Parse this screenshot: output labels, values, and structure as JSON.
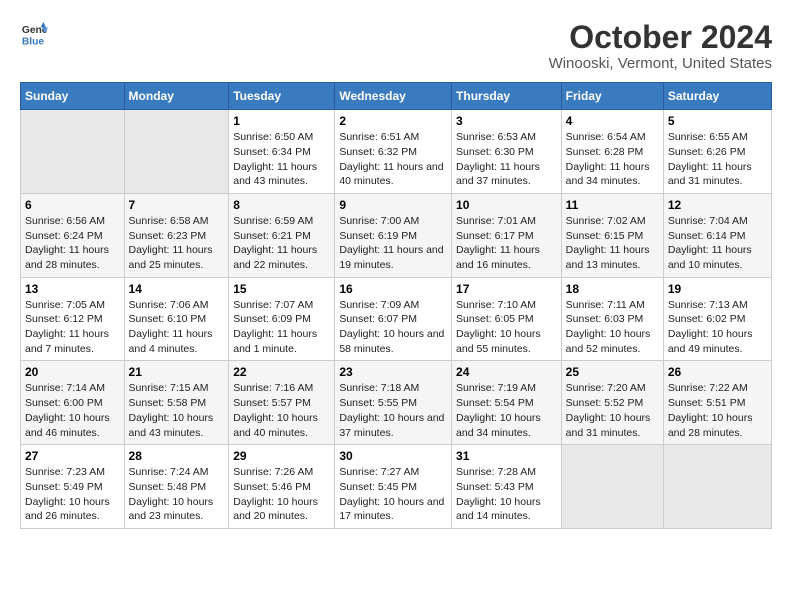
{
  "header": {
    "logo_line1": "General",
    "logo_line2": "Blue",
    "title": "October 2024",
    "subtitle": "Winooski, Vermont, United States"
  },
  "days_of_week": [
    "Sunday",
    "Monday",
    "Tuesday",
    "Wednesday",
    "Thursday",
    "Friday",
    "Saturday"
  ],
  "weeks": [
    [
      {
        "day": "",
        "empty": true
      },
      {
        "day": "",
        "empty": true
      },
      {
        "day": "1",
        "sunrise": "6:50 AM",
        "sunset": "6:34 PM",
        "daylight": "11 hours and 43 minutes."
      },
      {
        "day": "2",
        "sunrise": "6:51 AM",
        "sunset": "6:32 PM",
        "daylight": "11 hours and 40 minutes."
      },
      {
        "day": "3",
        "sunrise": "6:53 AM",
        "sunset": "6:30 PM",
        "daylight": "11 hours and 37 minutes."
      },
      {
        "day": "4",
        "sunrise": "6:54 AM",
        "sunset": "6:28 PM",
        "daylight": "11 hours and 34 minutes."
      },
      {
        "day": "5",
        "sunrise": "6:55 AM",
        "sunset": "6:26 PM",
        "daylight": "11 hours and 31 minutes."
      }
    ],
    [
      {
        "day": "6",
        "sunrise": "6:56 AM",
        "sunset": "6:24 PM",
        "daylight": "11 hours and 28 minutes."
      },
      {
        "day": "7",
        "sunrise": "6:58 AM",
        "sunset": "6:23 PM",
        "daylight": "11 hours and 25 minutes."
      },
      {
        "day": "8",
        "sunrise": "6:59 AM",
        "sunset": "6:21 PM",
        "daylight": "11 hours and 22 minutes."
      },
      {
        "day": "9",
        "sunrise": "7:00 AM",
        "sunset": "6:19 PM",
        "daylight": "11 hours and 19 minutes."
      },
      {
        "day": "10",
        "sunrise": "7:01 AM",
        "sunset": "6:17 PM",
        "daylight": "11 hours and 16 minutes."
      },
      {
        "day": "11",
        "sunrise": "7:02 AM",
        "sunset": "6:15 PM",
        "daylight": "11 hours and 13 minutes."
      },
      {
        "day": "12",
        "sunrise": "7:04 AM",
        "sunset": "6:14 PM",
        "daylight": "11 hours and 10 minutes."
      }
    ],
    [
      {
        "day": "13",
        "sunrise": "7:05 AM",
        "sunset": "6:12 PM",
        "daylight": "11 hours and 7 minutes."
      },
      {
        "day": "14",
        "sunrise": "7:06 AM",
        "sunset": "6:10 PM",
        "daylight": "11 hours and 4 minutes."
      },
      {
        "day": "15",
        "sunrise": "7:07 AM",
        "sunset": "6:09 PM",
        "daylight": "11 hours and 1 minute."
      },
      {
        "day": "16",
        "sunrise": "7:09 AM",
        "sunset": "6:07 PM",
        "daylight": "10 hours and 58 minutes."
      },
      {
        "day": "17",
        "sunrise": "7:10 AM",
        "sunset": "6:05 PM",
        "daylight": "10 hours and 55 minutes."
      },
      {
        "day": "18",
        "sunrise": "7:11 AM",
        "sunset": "6:03 PM",
        "daylight": "10 hours and 52 minutes."
      },
      {
        "day": "19",
        "sunrise": "7:13 AM",
        "sunset": "6:02 PM",
        "daylight": "10 hours and 49 minutes."
      }
    ],
    [
      {
        "day": "20",
        "sunrise": "7:14 AM",
        "sunset": "6:00 PM",
        "daylight": "10 hours and 46 minutes."
      },
      {
        "day": "21",
        "sunrise": "7:15 AM",
        "sunset": "5:58 PM",
        "daylight": "10 hours and 43 minutes."
      },
      {
        "day": "22",
        "sunrise": "7:16 AM",
        "sunset": "5:57 PM",
        "daylight": "10 hours and 40 minutes."
      },
      {
        "day": "23",
        "sunrise": "7:18 AM",
        "sunset": "5:55 PM",
        "daylight": "10 hours and 37 minutes."
      },
      {
        "day": "24",
        "sunrise": "7:19 AM",
        "sunset": "5:54 PM",
        "daylight": "10 hours and 34 minutes."
      },
      {
        "day": "25",
        "sunrise": "7:20 AM",
        "sunset": "5:52 PM",
        "daylight": "10 hours and 31 minutes."
      },
      {
        "day": "26",
        "sunrise": "7:22 AM",
        "sunset": "5:51 PM",
        "daylight": "10 hours and 28 minutes."
      }
    ],
    [
      {
        "day": "27",
        "sunrise": "7:23 AM",
        "sunset": "5:49 PM",
        "daylight": "10 hours and 26 minutes."
      },
      {
        "day": "28",
        "sunrise": "7:24 AM",
        "sunset": "5:48 PM",
        "daylight": "10 hours and 23 minutes."
      },
      {
        "day": "29",
        "sunrise": "7:26 AM",
        "sunset": "5:46 PM",
        "daylight": "10 hours and 20 minutes."
      },
      {
        "day": "30",
        "sunrise": "7:27 AM",
        "sunset": "5:45 PM",
        "daylight": "10 hours and 17 minutes."
      },
      {
        "day": "31",
        "sunrise": "7:28 AM",
        "sunset": "5:43 PM",
        "daylight": "10 hours and 14 minutes."
      },
      {
        "day": "",
        "empty": true
      },
      {
        "day": "",
        "empty": true
      }
    ]
  ],
  "labels": {
    "sunrise": "Sunrise:",
    "sunset": "Sunset:",
    "daylight": "Daylight:"
  }
}
